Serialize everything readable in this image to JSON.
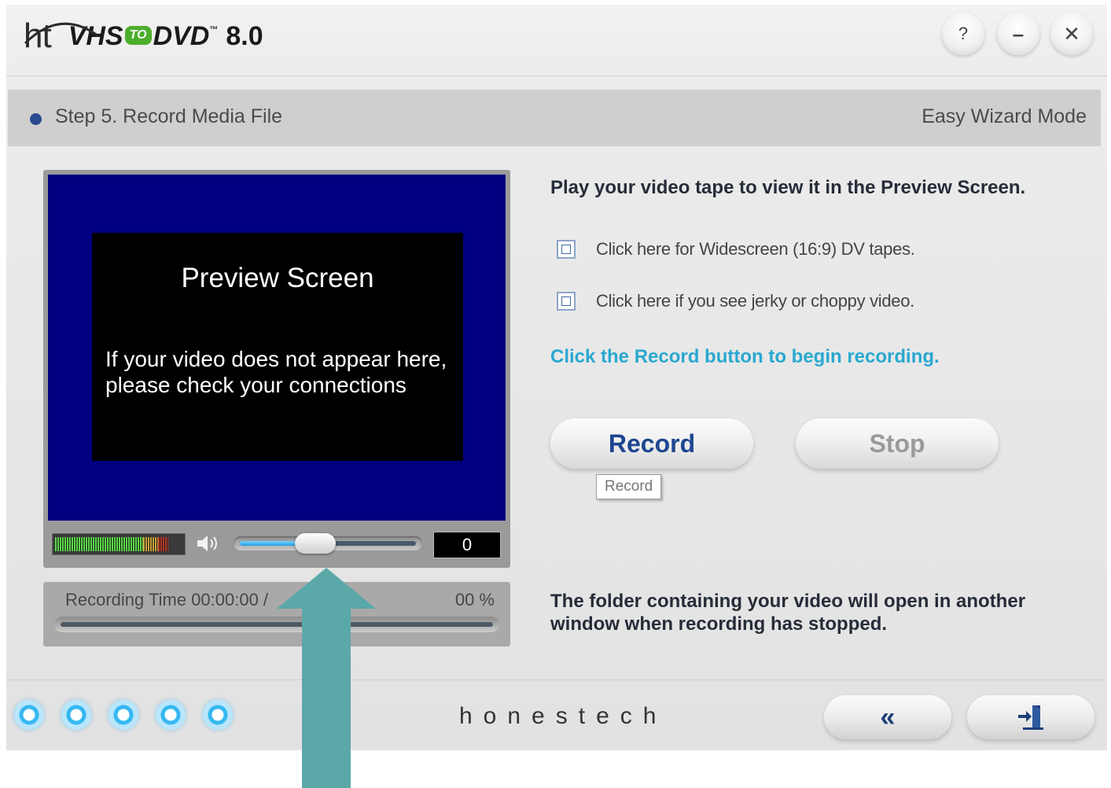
{
  "app": {
    "logo_ht": "ht",
    "logo_product_prefix": "VHS",
    "logo_product_to": "TO",
    "logo_product_suffix": "DVD",
    "logo_tm": "™",
    "logo_version": "8.0"
  },
  "window_buttons": {
    "help": "?",
    "minimize": "–",
    "close": "✕"
  },
  "stepbar": {
    "step": "Step 5. Record Media File",
    "mode": "Easy Wizard Mode"
  },
  "preview": {
    "title": "Preview Screen",
    "message_line1": "If your video does not appear here,",
    "message_line2": "please check your connections",
    "volume_level": 0.43,
    "meter_level": 0.9,
    "counter": "0"
  },
  "recording": {
    "time_label": "Recording Time  00:00:00 /",
    "percent": "00 %"
  },
  "instructions": {
    "play_text": "Play your video tape to view it in the Preview Screen.",
    "option_widescreen": "Click here for Widescreen (16:9) DV tapes.",
    "option_jerky": "Click here if you see jerky or choppy video.",
    "cta": "Click the Record button to begin recording.",
    "footnote": "The folder containing your video will open in another window when recording has stopped."
  },
  "buttons": {
    "record": "Record",
    "stop": "Stop",
    "record_tooltip": "Record",
    "back": "«",
    "exit_icon": "exit-door-icon"
  },
  "footer": {
    "brand": "honestech",
    "step_dots": 5
  },
  "colors": {
    "preview_bg": "#000080",
    "cta": "#29a8d0",
    "record_label": "#1e4690",
    "stop_label": "#9a9a9a",
    "step_dot": "#2a4a8e",
    "annotation_arrow": "#5ba8a8"
  }
}
